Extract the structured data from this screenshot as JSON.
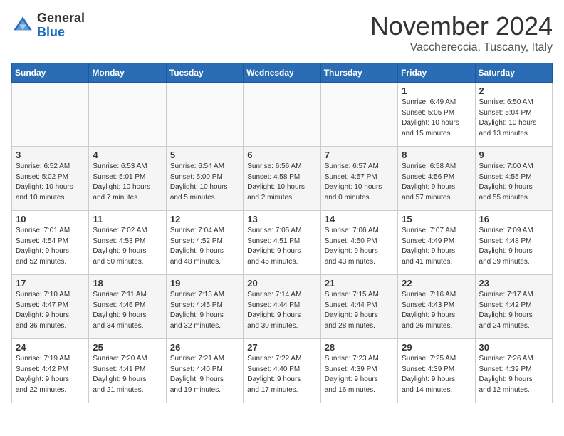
{
  "header": {
    "logo_line1": "General",
    "logo_line2": "Blue",
    "month_title": "November 2024",
    "subtitle": "Vacchereccia, Tuscany, Italy"
  },
  "weekdays": [
    "Sunday",
    "Monday",
    "Tuesday",
    "Wednesday",
    "Thursday",
    "Friday",
    "Saturday"
  ],
  "weeks": [
    [
      {
        "day": "",
        "info": ""
      },
      {
        "day": "",
        "info": ""
      },
      {
        "day": "",
        "info": ""
      },
      {
        "day": "",
        "info": ""
      },
      {
        "day": "",
        "info": ""
      },
      {
        "day": "1",
        "info": "Sunrise: 6:49 AM\nSunset: 5:05 PM\nDaylight: 10 hours\nand 15 minutes."
      },
      {
        "day": "2",
        "info": "Sunrise: 6:50 AM\nSunset: 5:04 PM\nDaylight: 10 hours\nand 13 minutes."
      }
    ],
    [
      {
        "day": "3",
        "info": "Sunrise: 6:52 AM\nSunset: 5:02 PM\nDaylight: 10 hours\nand 10 minutes."
      },
      {
        "day": "4",
        "info": "Sunrise: 6:53 AM\nSunset: 5:01 PM\nDaylight: 10 hours\nand 7 minutes."
      },
      {
        "day": "5",
        "info": "Sunrise: 6:54 AM\nSunset: 5:00 PM\nDaylight: 10 hours\nand 5 minutes."
      },
      {
        "day": "6",
        "info": "Sunrise: 6:56 AM\nSunset: 4:58 PM\nDaylight: 10 hours\nand 2 minutes."
      },
      {
        "day": "7",
        "info": "Sunrise: 6:57 AM\nSunset: 4:57 PM\nDaylight: 10 hours\nand 0 minutes."
      },
      {
        "day": "8",
        "info": "Sunrise: 6:58 AM\nSunset: 4:56 PM\nDaylight: 9 hours\nand 57 minutes."
      },
      {
        "day": "9",
        "info": "Sunrise: 7:00 AM\nSunset: 4:55 PM\nDaylight: 9 hours\nand 55 minutes."
      }
    ],
    [
      {
        "day": "10",
        "info": "Sunrise: 7:01 AM\nSunset: 4:54 PM\nDaylight: 9 hours\nand 52 minutes."
      },
      {
        "day": "11",
        "info": "Sunrise: 7:02 AM\nSunset: 4:53 PM\nDaylight: 9 hours\nand 50 minutes."
      },
      {
        "day": "12",
        "info": "Sunrise: 7:04 AM\nSunset: 4:52 PM\nDaylight: 9 hours\nand 48 minutes."
      },
      {
        "day": "13",
        "info": "Sunrise: 7:05 AM\nSunset: 4:51 PM\nDaylight: 9 hours\nand 45 minutes."
      },
      {
        "day": "14",
        "info": "Sunrise: 7:06 AM\nSunset: 4:50 PM\nDaylight: 9 hours\nand 43 minutes."
      },
      {
        "day": "15",
        "info": "Sunrise: 7:07 AM\nSunset: 4:49 PM\nDaylight: 9 hours\nand 41 minutes."
      },
      {
        "day": "16",
        "info": "Sunrise: 7:09 AM\nSunset: 4:48 PM\nDaylight: 9 hours\nand 39 minutes."
      }
    ],
    [
      {
        "day": "17",
        "info": "Sunrise: 7:10 AM\nSunset: 4:47 PM\nDaylight: 9 hours\nand 36 minutes."
      },
      {
        "day": "18",
        "info": "Sunrise: 7:11 AM\nSunset: 4:46 PM\nDaylight: 9 hours\nand 34 minutes."
      },
      {
        "day": "19",
        "info": "Sunrise: 7:13 AM\nSunset: 4:45 PM\nDaylight: 9 hours\nand 32 minutes."
      },
      {
        "day": "20",
        "info": "Sunrise: 7:14 AM\nSunset: 4:44 PM\nDaylight: 9 hours\nand 30 minutes."
      },
      {
        "day": "21",
        "info": "Sunrise: 7:15 AM\nSunset: 4:44 PM\nDaylight: 9 hours\nand 28 minutes."
      },
      {
        "day": "22",
        "info": "Sunrise: 7:16 AM\nSunset: 4:43 PM\nDaylight: 9 hours\nand 26 minutes."
      },
      {
        "day": "23",
        "info": "Sunrise: 7:17 AM\nSunset: 4:42 PM\nDaylight: 9 hours\nand 24 minutes."
      }
    ],
    [
      {
        "day": "24",
        "info": "Sunrise: 7:19 AM\nSunset: 4:42 PM\nDaylight: 9 hours\nand 22 minutes."
      },
      {
        "day": "25",
        "info": "Sunrise: 7:20 AM\nSunset: 4:41 PM\nDaylight: 9 hours\nand 21 minutes."
      },
      {
        "day": "26",
        "info": "Sunrise: 7:21 AM\nSunset: 4:40 PM\nDaylight: 9 hours\nand 19 minutes."
      },
      {
        "day": "27",
        "info": "Sunrise: 7:22 AM\nSunset: 4:40 PM\nDaylight: 9 hours\nand 17 minutes."
      },
      {
        "day": "28",
        "info": "Sunrise: 7:23 AM\nSunset: 4:39 PM\nDaylight: 9 hours\nand 16 minutes."
      },
      {
        "day": "29",
        "info": "Sunrise: 7:25 AM\nSunset: 4:39 PM\nDaylight: 9 hours\nand 14 minutes."
      },
      {
        "day": "30",
        "info": "Sunrise: 7:26 AM\nSunset: 4:39 PM\nDaylight: 9 hours\nand 12 minutes."
      }
    ]
  ]
}
